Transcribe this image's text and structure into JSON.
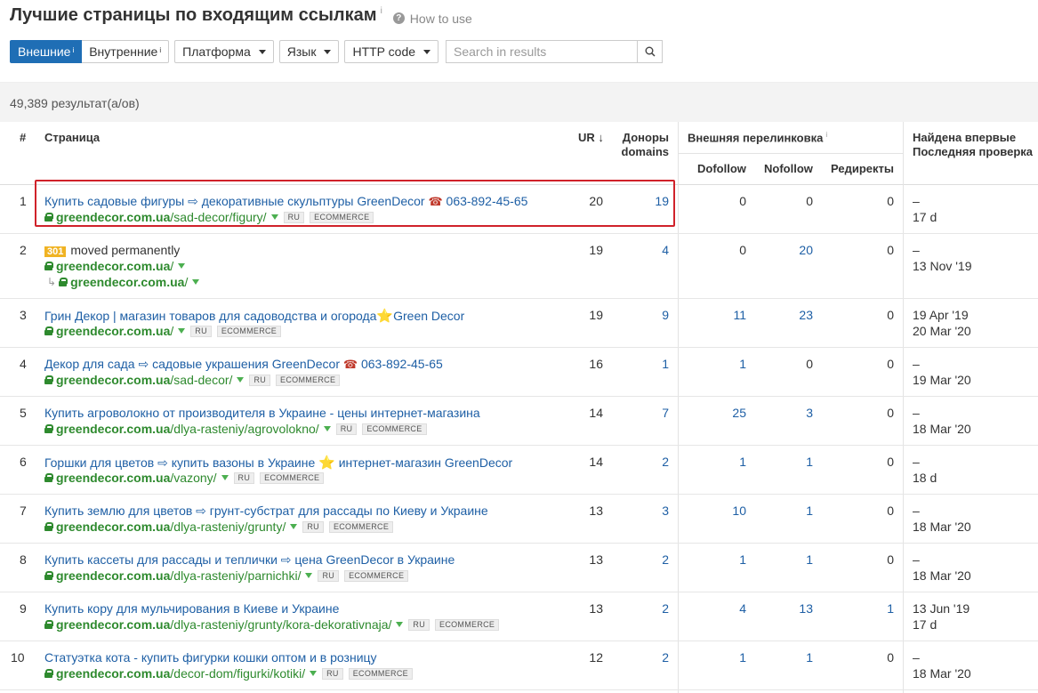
{
  "title": "Лучшие страницы по входящим ссылкам",
  "title_info": "i",
  "how_to_use": "How to use",
  "tabs": [
    {
      "label": "Внешние",
      "sup": "i",
      "active": true
    },
    {
      "label": "Внутренние",
      "sup": "i",
      "active": false
    }
  ],
  "filters": [
    "Платформа",
    "Язык",
    "HTTP code"
  ],
  "search": {
    "placeholder": "Search in results"
  },
  "results_count": "49,389 результат(а/ов)",
  "columns": {
    "num": "#",
    "page": "Страница",
    "ur": "UR",
    "donors": "Доноры domains",
    "external": "Внешняя перелинковка",
    "external_info": "i",
    "dofollow": "Dofollow",
    "nofollow": "Nofollow",
    "redirects": "Редиректы",
    "found": "Найдена впервые",
    "checked": "Последняя проверка"
  },
  "rows": [
    {
      "num": "1",
      "title": "Купить садовые фигуры ⇨ декоративные скульптуры GreenDecor ☎ 063-892-45-65",
      "domain": "greendecor.com.ua",
      "path": "/sad-decor/figury/",
      "tags": [
        "RU",
        "ECOMMERCE"
      ],
      "ur": "20",
      "donors": "19",
      "dofollow": "0",
      "nofollow": "0",
      "redirects": "0",
      "found": "–",
      "checked": "17 d"
    },
    {
      "num": "2",
      "badge": "301",
      "title": "moved permanently",
      "domain": "greendecor.com.ua",
      "path": "/",
      "redirect_domain": "greendecor.com.ua",
      "redirect_path": "/",
      "tags": [],
      "ur": "19",
      "donors": "4",
      "dofollow": "0",
      "nofollow": "20",
      "redirects": "0",
      "found": "–",
      "checked": "13 Nov '19"
    },
    {
      "num": "3",
      "title": "Грин Декор | магазин товаров для садоводства и огорода⭐Green Decor",
      "domain": "greendecor.com.ua",
      "path": "/",
      "tags": [
        "RU",
        "ECOMMERCE"
      ],
      "ur": "19",
      "donors": "9",
      "dofollow": "11",
      "nofollow": "23",
      "redirects": "0",
      "found": "19 Apr '19",
      "checked": "20 Mar '20"
    },
    {
      "num": "4",
      "title": "Декор для сада ⇨ садовые украшения GreenDecor ☎ 063-892-45-65",
      "domain": "greendecor.com.ua",
      "path": "/sad-decor/",
      "tags": [
        "RU",
        "ECOMMERCE"
      ],
      "ur": "16",
      "donors": "1",
      "dofollow": "1",
      "nofollow": "0",
      "redirects": "0",
      "found": "–",
      "checked": "19 Mar '20"
    },
    {
      "num": "5",
      "title": "Купить агроволокно от производителя в Украине - цены интернет-магазина",
      "domain": "greendecor.com.ua",
      "path": "/dlya-rasteniy/agrovolokno/",
      "tags": [
        "RU",
        "ECOMMERCE"
      ],
      "ur": "14",
      "donors": "7",
      "dofollow": "25",
      "nofollow": "3",
      "redirects": "0",
      "found": "–",
      "checked": "18 Mar '20"
    },
    {
      "num": "6",
      "title": "Горшки для цветов ⇨ купить вазоны в Украине ⭐ интернет-магазин GreenDecor",
      "domain": "greendecor.com.ua",
      "path": "/vazony/",
      "tags": [
        "RU",
        "ECOMMERCE"
      ],
      "ur": "14",
      "donors": "2",
      "dofollow": "1",
      "nofollow": "1",
      "redirects": "0",
      "found": "–",
      "checked": "18 d"
    },
    {
      "num": "7",
      "title": "Купить землю для цветов ⇨ грунт-субстрат для рассады по Киеву и Украине",
      "domain": "greendecor.com.ua",
      "path": "/dlya-rasteniy/grunty/",
      "tags": [
        "RU",
        "ECOMMERCE"
      ],
      "ur": "13",
      "donors": "3",
      "dofollow": "10",
      "nofollow": "1",
      "redirects": "0",
      "found": "–",
      "checked": "18 Mar '20"
    },
    {
      "num": "8",
      "title": "Купить кассеты для рассады и теплички ⇨ цена GreenDecor в Украине",
      "domain": "greendecor.com.ua",
      "path": "/dlya-rasteniy/parnichki/",
      "tags": [
        "RU",
        "ECOMMERCE"
      ],
      "ur": "13",
      "donors": "2",
      "dofollow": "1",
      "nofollow": "1",
      "redirects": "0",
      "found": "–",
      "checked": "18 Mar '20"
    },
    {
      "num": "9",
      "title": "Купить кору для мульчирования в Киеве и Украине",
      "domain": "greendecor.com.ua",
      "path": "/dlya-rasteniy/grunty/kora-dekorativnaja/",
      "tags": [
        "RU",
        "ECOMMERCE"
      ],
      "ur": "13",
      "donors": "2",
      "dofollow": "4",
      "nofollow": "13",
      "redirects": "1",
      "found": "13 Jun '19",
      "checked": "17 d"
    },
    {
      "num": "10",
      "title": "Статуэтка кота - купить фигурки кошки оптом и в розницу",
      "domain": "greendecor.com.ua",
      "path": "/decor-dom/figurki/kotiki/",
      "tags": [
        "RU",
        "ECOMMERCE"
      ],
      "ur": "12",
      "donors": "2",
      "dofollow": "1",
      "nofollow": "1",
      "redirects": "0",
      "found": "–",
      "checked": "18 Mar '20"
    }
  ]
}
